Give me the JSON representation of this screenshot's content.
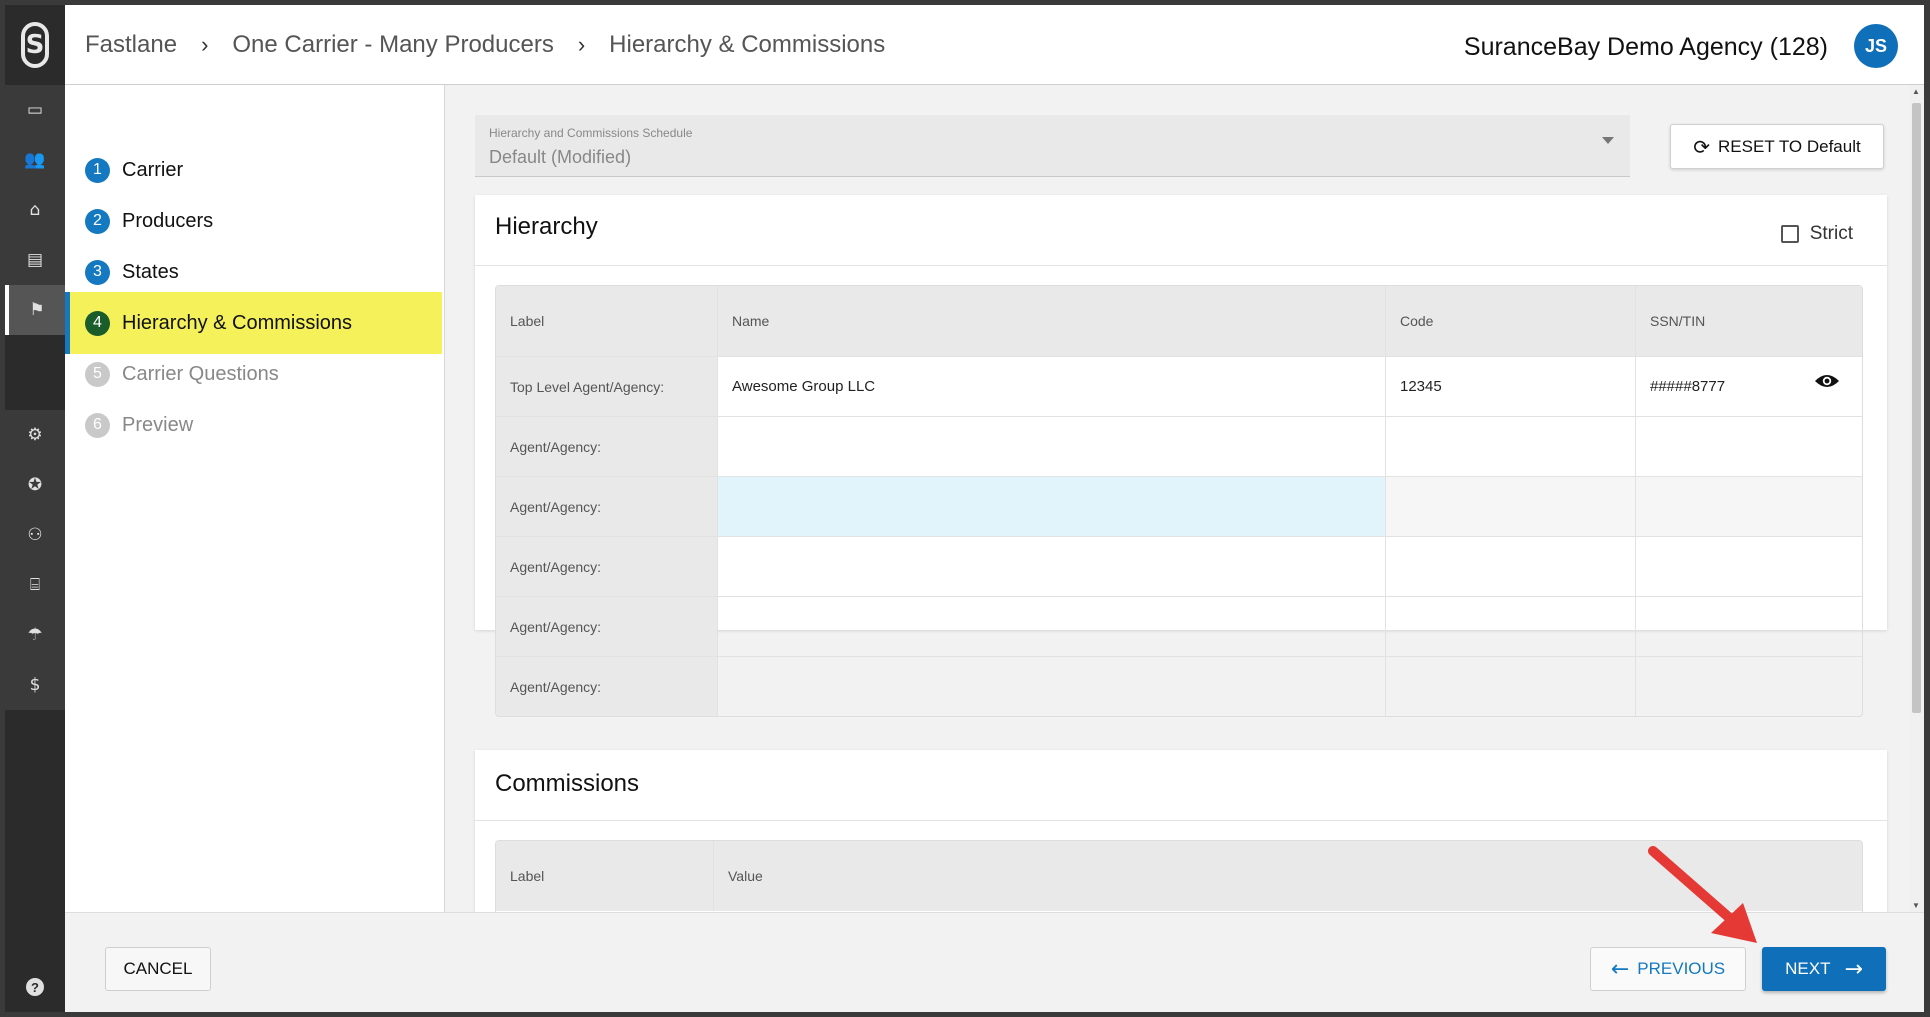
{
  "rail": {
    "top_icons": [
      "monitor-icon",
      "people-icon",
      "store-icon",
      "document-icon",
      "flag-icon"
    ],
    "bottom_icons": [
      "gear-icon",
      "badge-icon",
      "user-settings-icon",
      "bank-icon",
      "umbrella-icon",
      "dollar-icon"
    ],
    "icon_glyphs": {
      "monitor": "▭",
      "people": "👥",
      "store": "⌂",
      "document": "▤",
      "flag": "⚑",
      "gear": "⚙",
      "badge": "✪",
      "user_settings": "⚇",
      "bank": "⌸",
      "umbrella": "☂",
      "dollar": "$"
    },
    "help_glyph": "?"
  },
  "header": {
    "breadcrumbs": [
      "Fastlane",
      "One Carrier - Many Producers",
      "Hierarchy & Commissions"
    ],
    "separator": "›",
    "agency": "SuranceBay Demo Agency (128)",
    "avatar_initials": "JS"
  },
  "steps": [
    {
      "num": "1",
      "label": "Carrier",
      "state": "done"
    },
    {
      "num": "2",
      "label": "Producers",
      "state": "done"
    },
    {
      "num": "3",
      "label": "States",
      "state": "done"
    },
    {
      "num": "4",
      "label": "Hierarchy & Commissions",
      "state": "active"
    },
    {
      "num": "5",
      "label": "Carrier Questions",
      "state": "todo"
    },
    {
      "num": "6",
      "label": "Preview",
      "state": "todo"
    }
  ],
  "schedule": {
    "label": "Hierarchy and Commissions Schedule",
    "value": "Default  (Modified)"
  },
  "reset_button": "RESET TO Default",
  "hierarchy": {
    "title": "Hierarchy",
    "strict_label": "Strict",
    "columns": [
      "Label",
      "Name",
      "Code",
      "SSN/TIN"
    ],
    "rows": [
      {
        "label": "Top Level Agent/Agency:",
        "name": "Awesome Group LLC",
        "code": "12345",
        "ssn": "#####8777"
      },
      {
        "label": "Agent/Agency:",
        "name": "",
        "code": "",
        "ssn": ""
      },
      {
        "label": "Agent/Agency:",
        "name": "",
        "code": "",
        "ssn": ""
      },
      {
        "label": "Agent/Agency:",
        "name": "",
        "code": "",
        "ssn": ""
      },
      {
        "label": "Agent/Agency:",
        "name": "",
        "code": "",
        "ssn": ""
      },
      {
        "label": "Agent/Agency:",
        "name": "",
        "code": "",
        "ssn": ""
      }
    ]
  },
  "commissions": {
    "title": "Commissions",
    "columns": [
      "Label",
      "Value"
    ]
  },
  "footer": {
    "cancel": "CANCEL",
    "previous": "PREVIOUS",
    "next": "NEXT",
    "prev_arrow": "←",
    "next_arrow": "→"
  },
  "colors": {
    "brand_blue": "#0f6fb8",
    "active_step_bg": "#f4f15a",
    "annotation_red": "#e53935"
  }
}
